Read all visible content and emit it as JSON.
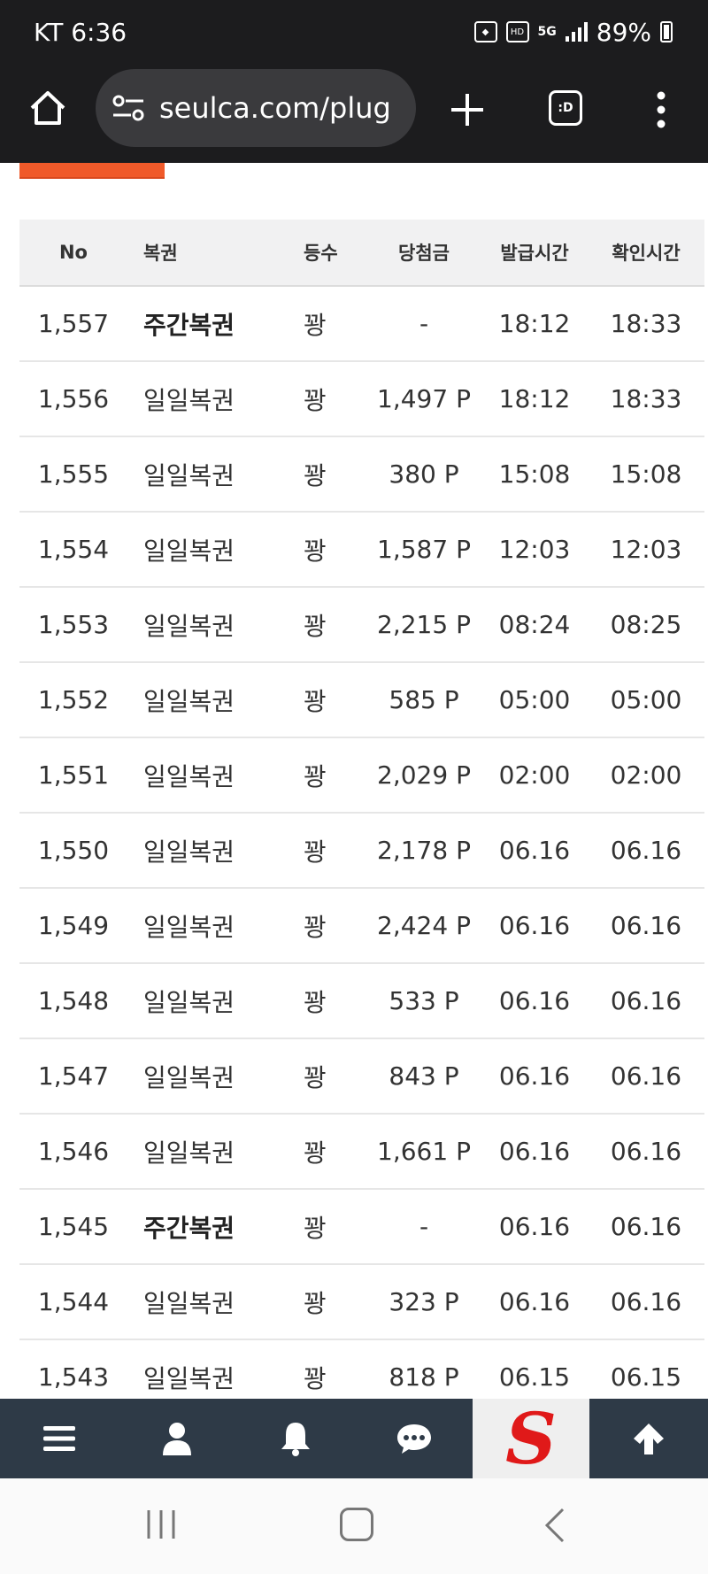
{
  "status_bar": {
    "carrier_time": "KT 6:36",
    "battery": "89%",
    "network": "5G",
    "hd": "HD"
  },
  "browser": {
    "url": "seulca.com/plug",
    "tabs_label": ":D"
  },
  "table": {
    "headers": {
      "no": "No",
      "type": "복권",
      "rank": "등수",
      "prize": "당첨금",
      "issued": "발급시간",
      "checked": "확인시간"
    },
    "rows": [
      {
        "no": "1,557",
        "type": "주간복권",
        "weekly": true,
        "rank": "꽝",
        "prize": "-",
        "issued": "18:12",
        "checked": "18:33"
      },
      {
        "no": "1,556",
        "type": "일일복권",
        "weekly": false,
        "rank": "꽝",
        "prize": "1,497 P",
        "issued": "18:12",
        "checked": "18:33"
      },
      {
        "no": "1,555",
        "type": "일일복권",
        "weekly": false,
        "rank": "꽝",
        "prize": "380 P",
        "issued": "15:08",
        "checked": "15:08"
      },
      {
        "no": "1,554",
        "type": "일일복권",
        "weekly": false,
        "rank": "꽝",
        "prize": "1,587 P",
        "issued": "12:03",
        "checked": "12:03"
      },
      {
        "no": "1,553",
        "type": "일일복권",
        "weekly": false,
        "rank": "꽝",
        "prize": "2,215 P",
        "issued": "08:24",
        "checked": "08:25"
      },
      {
        "no": "1,552",
        "type": "일일복권",
        "weekly": false,
        "rank": "꽝",
        "prize": "585 P",
        "issued": "05:00",
        "checked": "05:00"
      },
      {
        "no": "1,551",
        "type": "일일복권",
        "weekly": false,
        "rank": "꽝",
        "prize": "2,029 P",
        "issued": "02:00",
        "checked": "02:00"
      },
      {
        "no": "1,550",
        "type": "일일복권",
        "weekly": false,
        "rank": "꽝",
        "prize": "2,178 P",
        "issued": "06.16",
        "checked": "06.16"
      },
      {
        "no": "1,549",
        "type": "일일복권",
        "weekly": false,
        "rank": "꽝",
        "prize": "2,424 P",
        "issued": "06.16",
        "checked": "06.16"
      },
      {
        "no": "1,548",
        "type": "일일복권",
        "weekly": false,
        "rank": "꽝",
        "prize": "533 P",
        "issued": "06.16",
        "checked": "06.16"
      },
      {
        "no": "1,547",
        "type": "일일복권",
        "weekly": false,
        "rank": "꽝",
        "prize": "843 P",
        "issued": "06.16",
        "checked": "06.16"
      },
      {
        "no": "1,546",
        "type": "일일복권",
        "weekly": false,
        "rank": "꽝",
        "prize": "1,661 P",
        "issued": "06.16",
        "checked": "06.16"
      },
      {
        "no": "1,545",
        "type": "주간복권",
        "weekly": true,
        "rank": "꽝",
        "prize": "-",
        "issued": "06.16",
        "checked": "06.16"
      },
      {
        "no": "1,544",
        "type": "일일복권",
        "weekly": false,
        "rank": "꽝",
        "prize": "323 P",
        "issued": "06.16",
        "checked": "06.16"
      },
      {
        "no": "1,543",
        "type": "일일복권",
        "weekly": false,
        "rank": "꽝",
        "prize": "818 P",
        "issued": "06.15",
        "checked": "06.15"
      }
    ]
  },
  "bottom_nav": {
    "items": [
      "menu-icon",
      "user-icon",
      "bell-icon",
      "chat-icon",
      "site-logo",
      "arrow-up-icon"
    ],
    "logo_letter": "S"
  },
  "colors": {
    "accent": "#f05a2a",
    "nav_bg": "#2e3a47",
    "logo_red": "#e01919"
  }
}
